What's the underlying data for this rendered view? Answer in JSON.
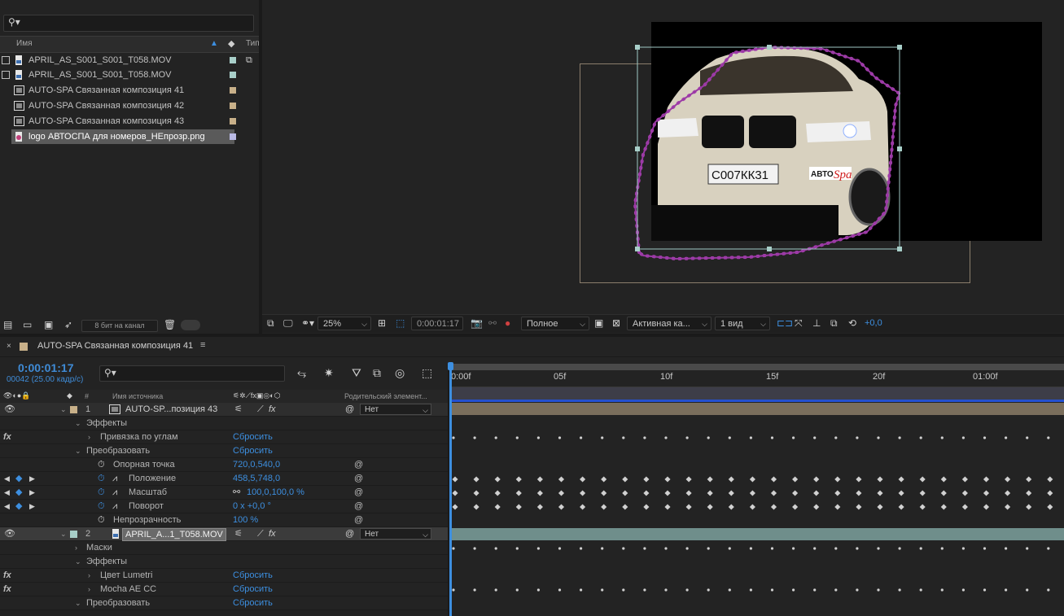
{
  "project": {
    "search_placeholder": "",
    "col_name": "Имя",
    "col_type": "Тип",
    "items": [
      {
        "name": "APRIL_AS_S001_S001_T058.MOV",
        "kind": "footage",
        "label_color": "#a8cfc9",
        "selected": false
      },
      {
        "name": "APRIL_AS_S001_S001_T058.MOV",
        "kind": "footage",
        "label_color": "#a8cfc9",
        "selected": false
      },
      {
        "name": "AUTO-SPA Связанная композиция 41",
        "kind": "comp",
        "label_color": "#c8b089",
        "selected": false
      },
      {
        "name": "AUTO-SPA Связанная композиция 42",
        "kind": "comp",
        "label_color": "#c8b089",
        "selected": false
      },
      {
        "name": "AUTO-SPA Связанная композиция 43",
        "kind": "comp",
        "label_color": "#c8b089",
        "selected": false
      },
      {
        "name": "logo АВТОСПА для номеров_НЕпрозр.png",
        "kind": "image",
        "label_color": "#b9b9e4",
        "selected": true
      }
    ],
    "bit_depth": "8 бит на канал"
  },
  "viewer": {
    "zoom": "25%",
    "timecode": "0:00:01:17",
    "resolution": "Полное",
    "camera": "Активная ка...",
    "views": "1 вид",
    "exposure": "+0,0",
    "plate_text": "C007КК31",
    "logo_text_left": "АВТО",
    "logo_text_right": "Spa"
  },
  "timeline": {
    "tab_title": "AUTO-SPA Связанная композиция 41",
    "timecode": "0:00:01:17",
    "frame_info": "00042 (25.00 кадр/с)",
    "col_source_name": "Имя источника",
    "col_parent": "Родительский элемент...",
    "col_num": "#",
    "ruler": [
      "0:00f",
      "05f",
      "10f",
      "15f",
      "20f",
      "01:00f"
    ],
    "rows": [
      {
        "type": "layer",
        "num": "1",
        "name": "AUTO-SP...позиция 43",
        "label_color": "#c8b089",
        "parent": "Нет"
      },
      {
        "type": "group",
        "name": "Эффекты"
      },
      {
        "type": "effect",
        "name": "Привязка по углам",
        "value": "Сбросить"
      },
      {
        "type": "group",
        "name": "Преобразовать",
        "value": "Сбросить"
      },
      {
        "type": "prop",
        "name": "Опорная точка",
        "value": "720,0,540,0",
        "keyed": false
      },
      {
        "type": "prop",
        "name": "Положение",
        "value": "458,5,748,0",
        "keyed": true
      },
      {
        "type": "prop",
        "name": "Масштаб",
        "value": "100,0,100,0 %",
        "keyed": true
      },
      {
        "type": "prop",
        "name": "Поворот",
        "value": "0 x +0,0 °",
        "keyed": true
      },
      {
        "type": "prop",
        "name": "Непрозрачность",
        "value": "100 %",
        "keyed": false
      },
      {
        "type": "layer",
        "num": "2",
        "name": "APRIL_A...1_T058.MOV",
        "label_color": "#a8cfc9",
        "parent": "Нет"
      },
      {
        "type": "group",
        "name": "Маски"
      },
      {
        "type": "group",
        "name": "Эффекты"
      },
      {
        "type": "effect",
        "name": "Цвет Lumetri",
        "value": "Сбросить"
      },
      {
        "type": "effect",
        "name": "Mocha AE CC",
        "value": "Сбросить"
      },
      {
        "type": "group",
        "name": "Преобразовать",
        "value": "Сбросить"
      }
    ]
  }
}
